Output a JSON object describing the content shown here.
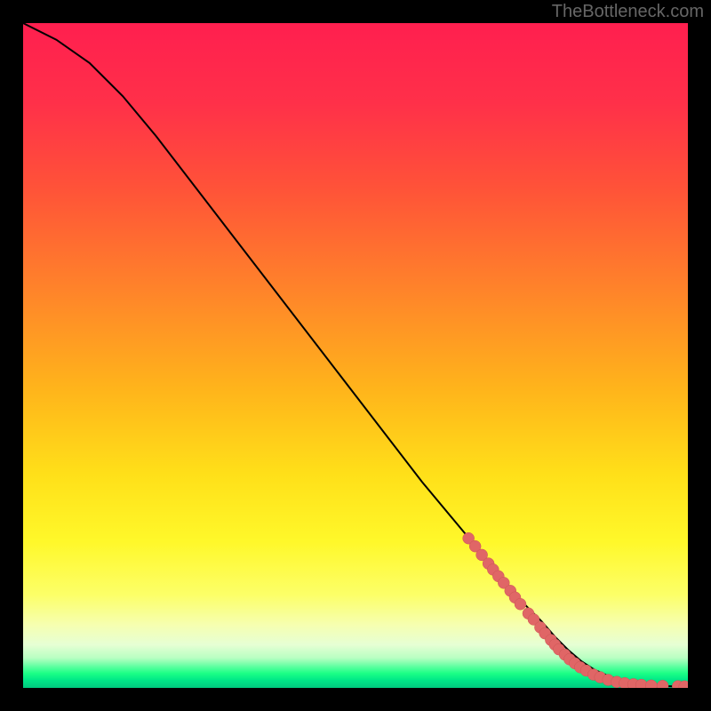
{
  "watermark": "TheBottleneck.com",
  "colors": {
    "frame": "#000000",
    "gradient_stops": [
      {
        "offset": 0.0,
        "color": "#ff1f4f"
      },
      {
        "offset": 0.12,
        "color": "#ff3049"
      },
      {
        "offset": 0.25,
        "color": "#ff5338"
      },
      {
        "offset": 0.4,
        "color": "#ff832a"
      },
      {
        "offset": 0.55,
        "color": "#ffb41b"
      },
      {
        "offset": 0.68,
        "color": "#ffe019"
      },
      {
        "offset": 0.78,
        "color": "#fff82a"
      },
      {
        "offset": 0.86,
        "color": "#fcff68"
      },
      {
        "offset": 0.905,
        "color": "#f6ffb0"
      },
      {
        "offset": 0.935,
        "color": "#e6ffd4"
      },
      {
        "offset": 0.955,
        "color": "#b8ffc2"
      },
      {
        "offset": 0.968,
        "color": "#5dffa0"
      },
      {
        "offset": 0.978,
        "color": "#1cff86"
      },
      {
        "offset": 0.988,
        "color": "#00e887"
      },
      {
        "offset": 1.0,
        "color": "#00c97f"
      }
    ],
    "line": "#000000",
    "marker_fill": "#e06666",
    "marker_stroke": "#cc5555"
  },
  "chart_data": {
    "type": "line",
    "title": "",
    "xlabel": "",
    "ylabel": "",
    "xlim": [
      0,
      100
    ],
    "ylim": [
      0,
      100
    ],
    "grid": false,
    "series": [
      {
        "name": "curve",
        "x": [
          0,
          5,
          10,
          15,
          20,
          25,
          30,
          35,
          40,
          45,
          50,
          55,
          60,
          65,
          70,
          75,
          78,
          80,
          82,
          84,
          86,
          88,
          90,
          92,
          94,
          96,
          98,
          100
        ],
        "y": [
          100,
          97.5,
          94,
          89,
          83,
          76.5,
          70,
          63.5,
          57,
          50.5,
          44,
          37.5,
          31,
          25,
          19,
          13,
          10,
          7.7,
          5.7,
          4.0,
          2.7,
          1.8,
          1.1,
          0.7,
          0.45,
          0.3,
          0.22,
          0.2
        ]
      }
    ],
    "markers": [
      {
        "x": 67.0,
        "y": 22.5
      },
      {
        "x": 68.0,
        "y": 21.3
      },
      {
        "x": 69.0,
        "y": 20.0
      },
      {
        "x": 70.0,
        "y": 18.7
      },
      {
        "x": 70.7,
        "y": 17.8
      },
      {
        "x": 71.5,
        "y": 16.8
      },
      {
        "x": 72.3,
        "y": 15.8
      },
      {
        "x": 73.3,
        "y": 14.6
      },
      {
        "x": 74.0,
        "y": 13.6
      },
      {
        "x": 74.8,
        "y": 12.6
      },
      {
        "x": 76.0,
        "y": 11.2
      },
      {
        "x": 76.8,
        "y": 10.3
      },
      {
        "x": 77.8,
        "y": 9.1
      },
      {
        "x": 78.5,
        "y": 8.2
      },
      {
        "x": 79.4,
        "y": 7.2
      },
      {
        "x": 80.0,
        "y": 6.5
      },
      {
        "x": 80.6,
        "y": 5.8
      },
      {
        "x": 81.5,
        "y": 5.0
      },
      {
        "x": 82.2,
        "y": 4.3
      },
      {
        "x": 83.0,
        "y": 3.7
      },
      {
        "x": 83.8,
        "y": 3.1
      },
      {
        "x": 84.7,
        "y": 2.6
      },
      {
        "x": 85.8,
        "y": 2.0
      },
      {
        "x": 86.8,
        "y": 1.6
      },
      {
        "x": 88.0,
        "y": 1.2
      },
      {
        "x": 89.3,
        "y": 0.9
      },
      {
        "x": 90.5,
        "y": 0.7
      },
      {
        "x": 91.8,
        "y": 0.55
      },
      {
        "x": 93.0,
        "y": 0.45
      },
      {
        "x": 94.5,
        "y": 0.35
      },
      {
        "x": 96.2,
        "y": 0.3
      },
      {
        "x": 98.5,
        "y": 0.25
      },
      {
        "x": 99.5,
        "y": 0.22
      }
    ]
  }
}
